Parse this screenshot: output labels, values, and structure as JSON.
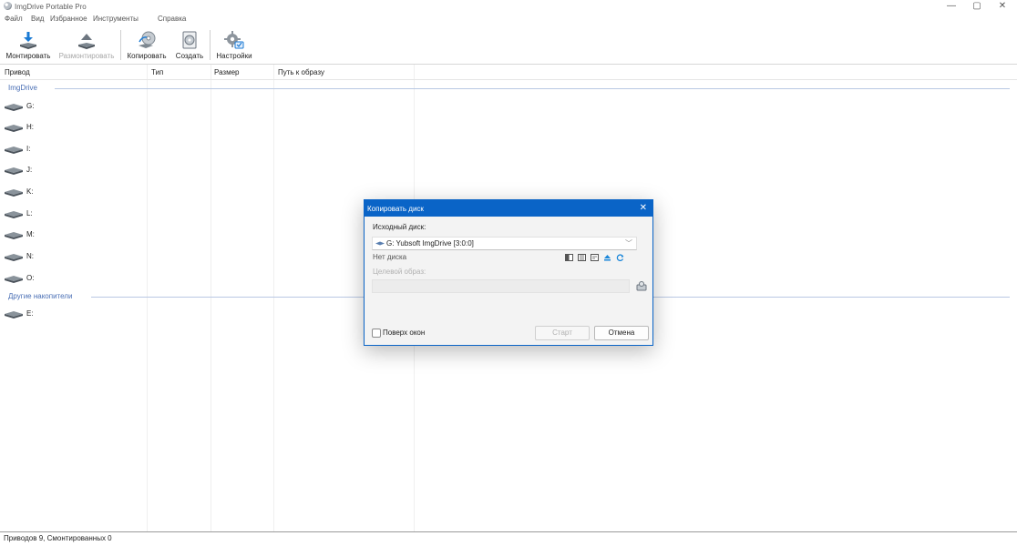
{
  "window": {
    "title": "ImgDrive Portable Pro",
    "controls": {
      "minimize": "—",
      "maximize": "▢",
      "close": "✕"
    }
  },
  "menu": [
    "Файл",
    "Вид",
    "Избранное",
    "Инструменты",
    "Справка"
  ],
  "toolbar": {
    "mount": "Монтировать",
    "unmount": "Размонтировать",
    "copy": "Копировать",
    "create": "Создать",
    "settings": "Настройки"
  },
  "columns": [
    "Привод",
    "Тип",
    "Размер",
    "Путь к образу"
  ],
  "groups": [
    {
      "name": "ImgDrive",
      "drives": [
        "G:",
        "H:",
        "I:",
        "J:",
        "K:",
        "L:",
        "M:",
        "N:",
        "O:"
      ]
    },
    {
      "name": "Другие накопители",
      "drives": [
        "E:"
      ]
    }
  ],
  "status": "Приводов 9, Смонтированных 0",
  "dialog": {
    "title": "Копировать диск",
    "close": "✕",
    "source_label": "Исходный диск:",
    "source_value": "G: Yubsoft ImgDrive [3:0:0]",
    "combo_arrow": "﹀",
    "no_disc": "Нет диска",
    "target_label": "Целевой образ:",
    "target_value": "",
    "on_top_label": "Поверх окон",
    "start": "Старт",
    "cancel": "Отмена"
  },
  "colors": {
    "accent": "#0a64c7",
    "group_text": "#4a6fb5",
    "refresh_icon": "#1a86d9"
  }
}
